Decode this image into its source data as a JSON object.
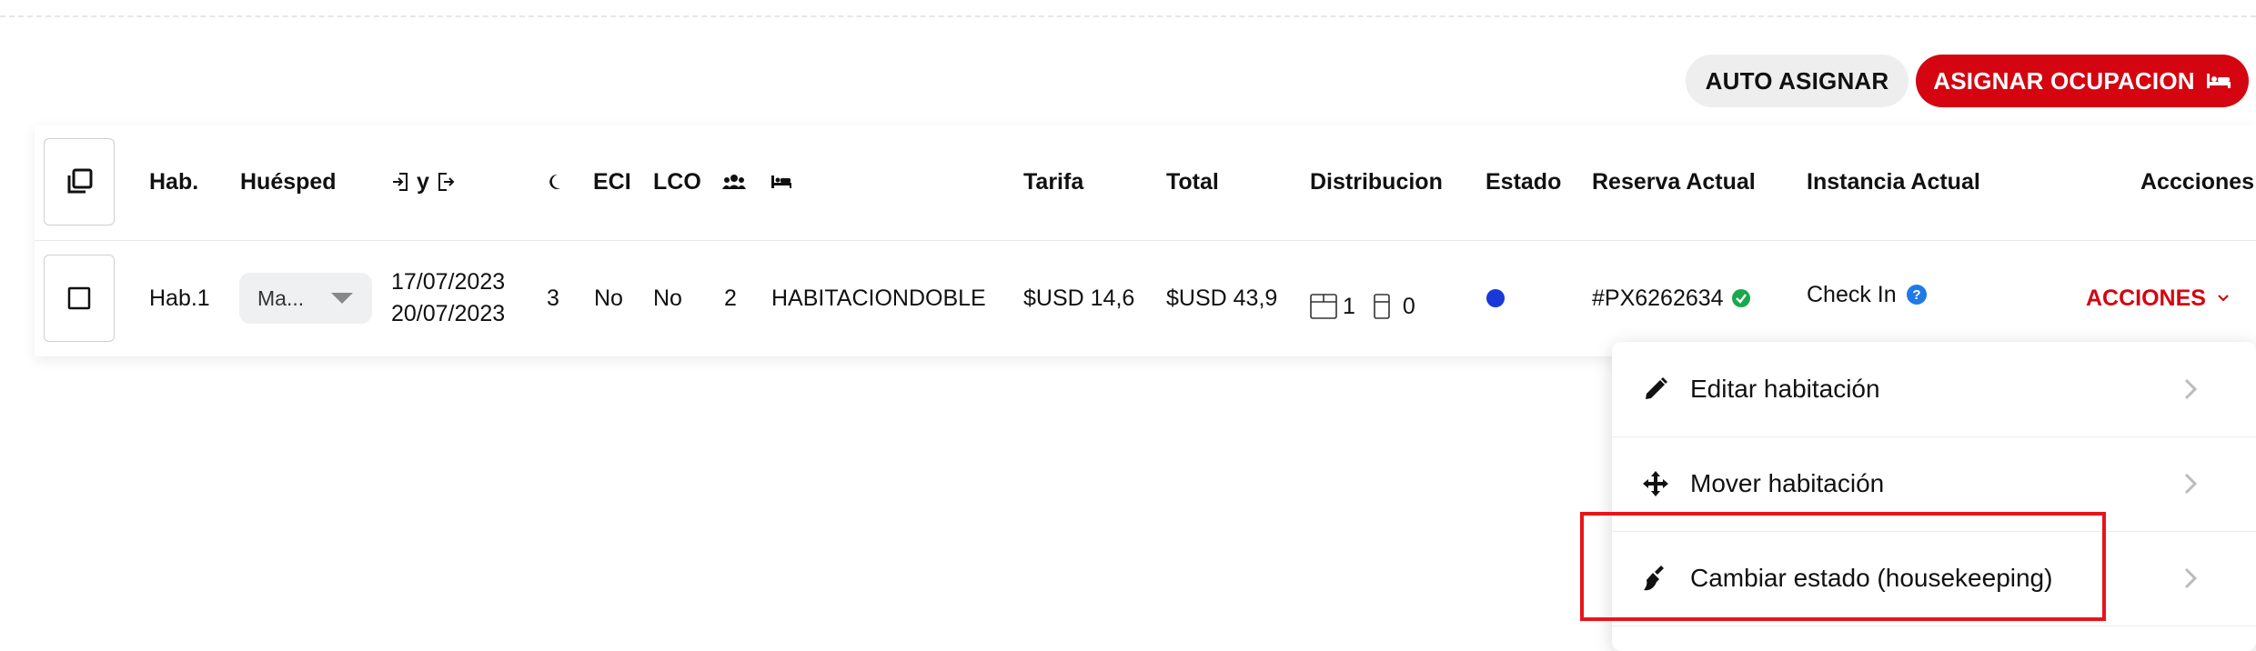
{
  "toolbar": {
    "auto_assign_label": "AUTO ASIGNAR",
    "assign_occupancy_label": "ASIGNAR OCUPACION",
    "assign_icon": "bed-icon"
  },
  "table": {
    "headers": {
      "room": "Hab.",
      "guest": "Huésped",
      "dates_joiner": "y",
      "eci": "ECI",
      "lco": "LCO",
      "rate": "Tarifa",
      "total": "Total",
      "distribution": "Distribucion",
      "status": "Estado",
      "current_booking": "Reserva Actual",
      "current_instance": "Instancia Actual",
      "actions": "Accciones"
    },
    "header_icons": {
      "select_all": "select-all-icon",
      "checkin": "login-icon",
      "checkout": "logout-icon",
      "nights": "moon-icon",
      "people": "people-icon",
      "bed": "bed-icon"
    },
    "row": {
      "room": "Hab.1",
      "guest": "Ma...",
      "checkin_date": "17/07/2023",
      "checkout_date": "20/07/2023",
      "nights": "3",
      "eci": "No",
      "lco": "No",
      "people": "2",
      "room_type": "HABITACIONDOBLE",
      "rate": "$USD 14,6",
      "total": "$USD 43,9",
      "double_beds": "1",
      "single_beds": "0",
      "status_color": "#1938d9",
      "booking": "#PX6262634",
      "booking_verified_color": "#1aa84b",
      "instance": "Check In",
      "actions_label": "ACCIONES"
    }
  },
  "dropdown": {
    "items": [
      {
        "label": "Editar habitación",
        "icon": "pencil-icon"
      },
      {
        "label": "Mover habitación",
        "icon": "move-icon"
      },
      {
        "label": "Cambiar estado (housekeeping)",
        "icon": "broom-icon"
      }
    ]
  },
  "colors": {
    "accent": "#d40511",
    "highlight": "#e8141a",
    "help": "#1e7ae6"
  }
}
